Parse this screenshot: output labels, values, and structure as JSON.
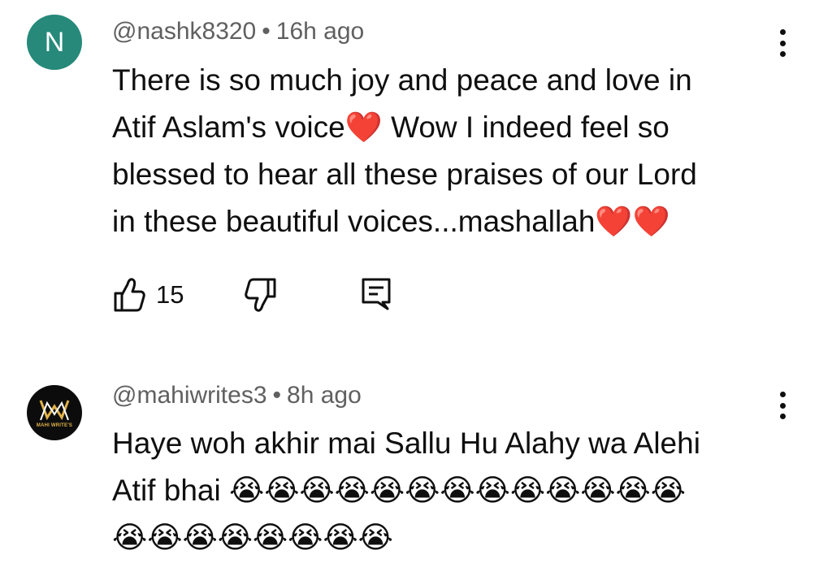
{
  "comments": [
    {
      "avatar_letter": "N",
      "avatar_color": "#26897a",
      "handle": "@nashk8320",
      "separator": "•",
      "time": "16h ago",
      "text_lines": [
        "There is so much joy and peace and love in",
        "Atif Aslam's voice❤️ Wow I indeed feel so",
        "blessed to hear all these praises of our Lord",
        "in these beautiful voices...mashallah❤️❤️"
      ],
      "like_count": "15",
      "icons": [
        "thumbs-up-icon",
        "thumbs-down-icon",
        "reply-icon",
        "more-vert-icon"
      ]
    },
    {
      "avatar_label": "MAHI WRITE'S",
      "avatar_color": "#0c0c0c",
      "handle": "@mahiwrites3",
      "separator": "•",
      "time": "8h ago",
      "text_lines": [
        "Haye woh akhir mai Sallu Hu Alahy wa Alehi",
        "Atif bhai 😭😭😭😭😭😭😭😭😭😭😭😭😭",
        "😭😭😭😭😭😭😭😭"
      ],
      "icons": [
        "more-vert-icon"
      ]
    }
  ],
  "colors": {
    "text": "#0f0f0f",
    "meta": "#606060",
    "logo_gold": "#e0b14a"
  }
}
